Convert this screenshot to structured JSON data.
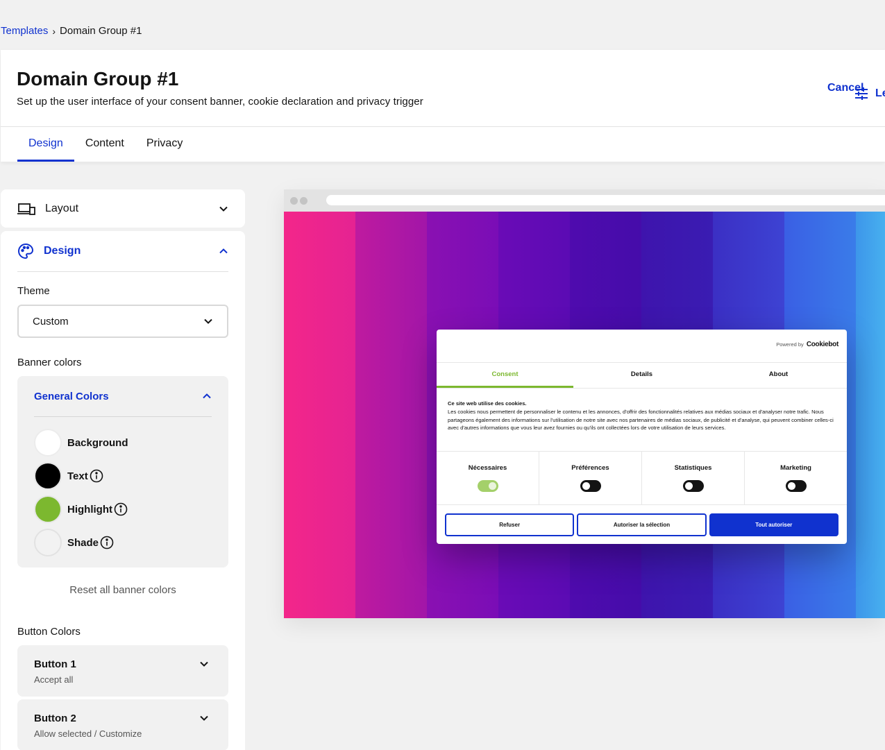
{
  "breadcrumb": {
    "parent": "Templates",
    "separator": "›",
    "current": "Domain Group #1"
  },
  "header": {
    "title": "Domain Group #1",
    "subtitle": "Set up the user interface of your consent banner, cookie declaration and privacy trigger",
    "cancel_label": "Cancel",
    "right_action_label": "Le"
  },
  "tabs": [
    {
      "label": "Design",
      "active": true
    },
    {
      "label": "Content",
      "active": false
    },
    {
      "label": "Privacy",
      "active": false
    }
  ],
  "sidebar": {
    "layout_label": "Layout",
    "design_label": "Design",
    "theme_title": "Theme",
    "theme_value": "Custom",
    "banner_colors_title": "Banner colors",
    "general_colors_label": "General Colors",
    "colors": [
      {
        "label": "Background",
        "color": "#ffffff",
        "info": false
      },
      {
        "label": "Text",
        "color": "#000000",
        "info": true
      },
      {
        "label": "Highlight",
        "color": "#7cb82f",
        "info": true
      },
      {
        "label": "Shade",
        "color": "#f2f2f2",
        "info": true
      }
    ],
    "reset_label": "Reset all banner colors",
    "button_colors_title": "Button Colors",
    "buttons": [
      {
        "title": "Button 1",
        "subtitle": "Accept all"
      },
      {
        "title": "Button 2",
        "subtitle": "Allow selected / Customize"
      }
    ]
  },
  "preview": {
    "powered_by": "Powered by",
    "logo_text": "Cookiebot",
    "tabs": [
      "Consent",
      "Details",
      "About"
    ],
    "heading": "Ce site web utilise des cookies.",
    "body": "Les cookies nous permettent de personnaliser le contenu et les annonces, d'offrir des fonctionnalités relatives aux médias sociaux et d'analyser notre trafic. Nous partageons également des informations sur l'utilisation de notre site avec nos partenaires de médias sociaux, de publicité et d'analyse, qui peuvent combiner celles-ci avec d'autres informations que vous leur avez fournies ou qu'ils ont collectées lors de votre utilisation de leurs services.",
    "categories": [
      {
        "label": "Nécessaires",
        "on": true
      },
      {
        "label": "Préférences",
        "on": false
      },
      {
        "label": "Statistiques",
        "on": false
      },
      {
        "label": "Marketing",
        "on": false
      }
    ],
    "buttons": [
      "Refuser",
      "Autoriser la sélection",
      "Tout autoriser"
    ]
  },
  "colors": {
    "accent": "#1032cf",
    "highlight": "#7cb82f"
  }
}
